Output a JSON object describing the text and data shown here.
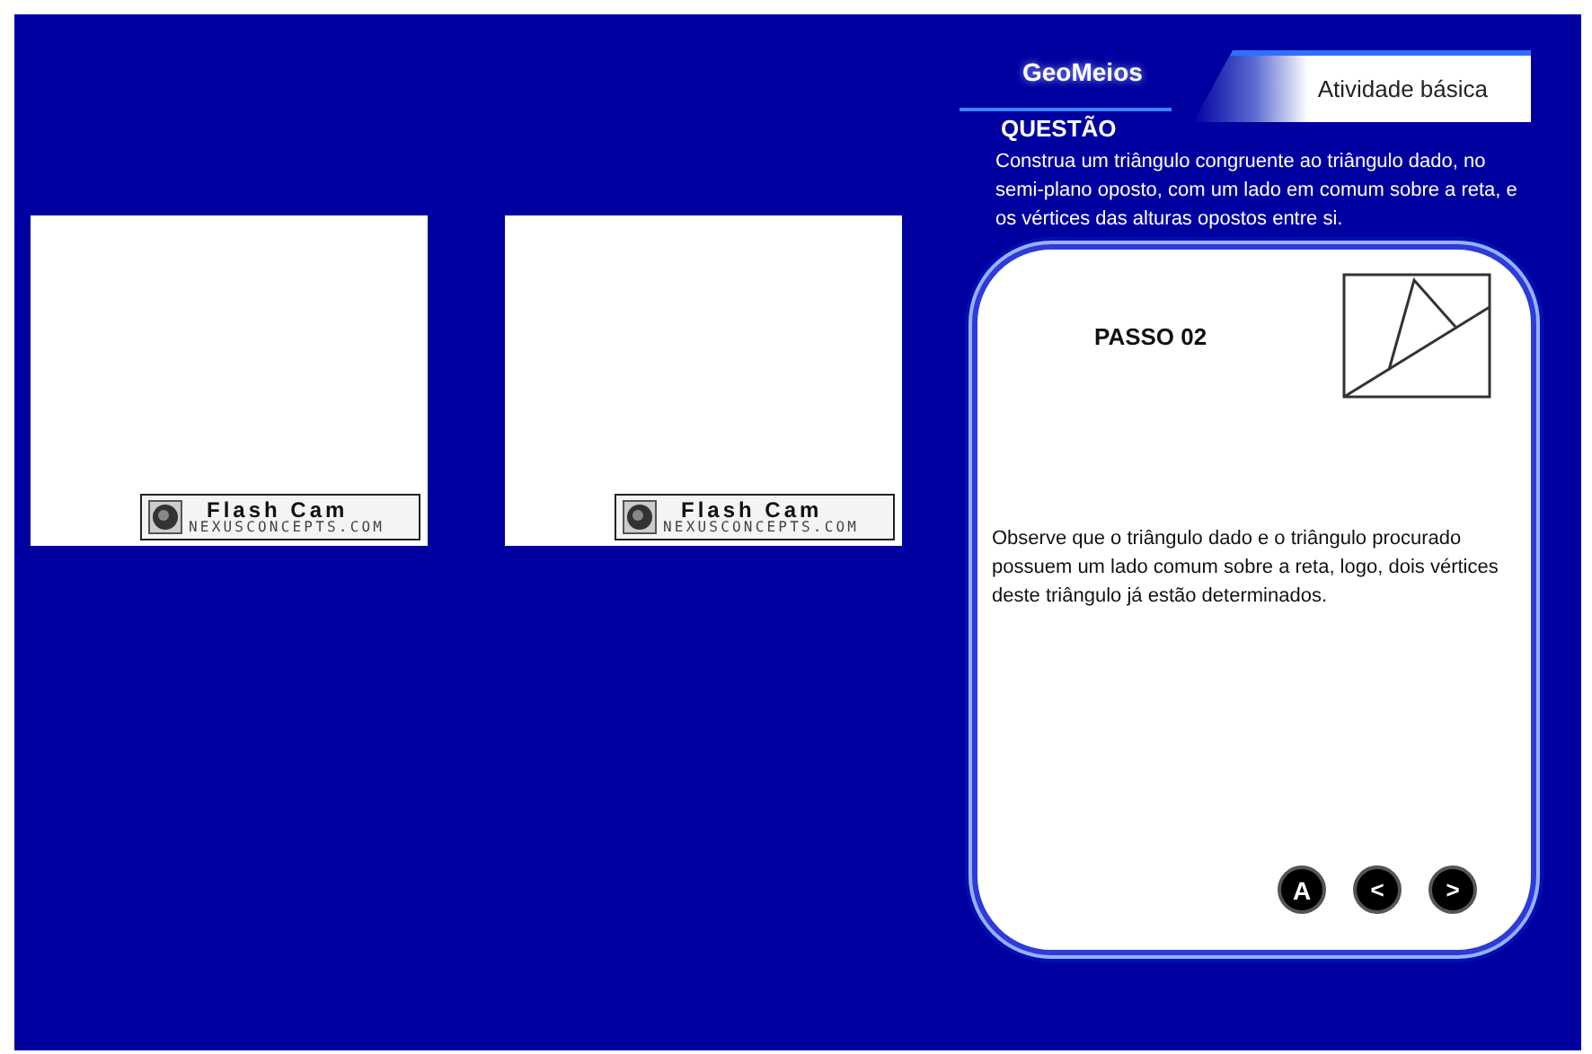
{
  "camera_panels": [
    {
      "badge_title": "Flash Cam",
      "badge_subtitle": "NEXUSCONCEPTS.COM"
    },
    {
      "badge_title": "Flash Cam",
      "badge_subtitle": "NEXUSCONCEPTS.COM"
    }
  ],
  "header": {
    "brand": "GeoMeios",
    "tab": "Atividade básica"
  },
  "question": {
    "heading": "QUESTÃO",
    "text": "Construa um triângulo congruente ao triângulo dado, no semi-plano oposto, com um lado em comum sobre a reta, e os vértices das alturas opostos entre si."
  },
  "step": {
    "title": "PASSO 02",
    "text": "Observe que o triângulo dado e o triângulo procurado possuem um lado comum sobre a reta, logo, dois vértices deste triângulo já estão determinados."
  },
  "nav_buttons": [
    {
      "kind": "answer",
      "label": "A"
    },
    {
      "kind": "previous",
      "label": "<"
    },
    {
      "kind": "next",
      "label": ">"
    }
  ]
}
